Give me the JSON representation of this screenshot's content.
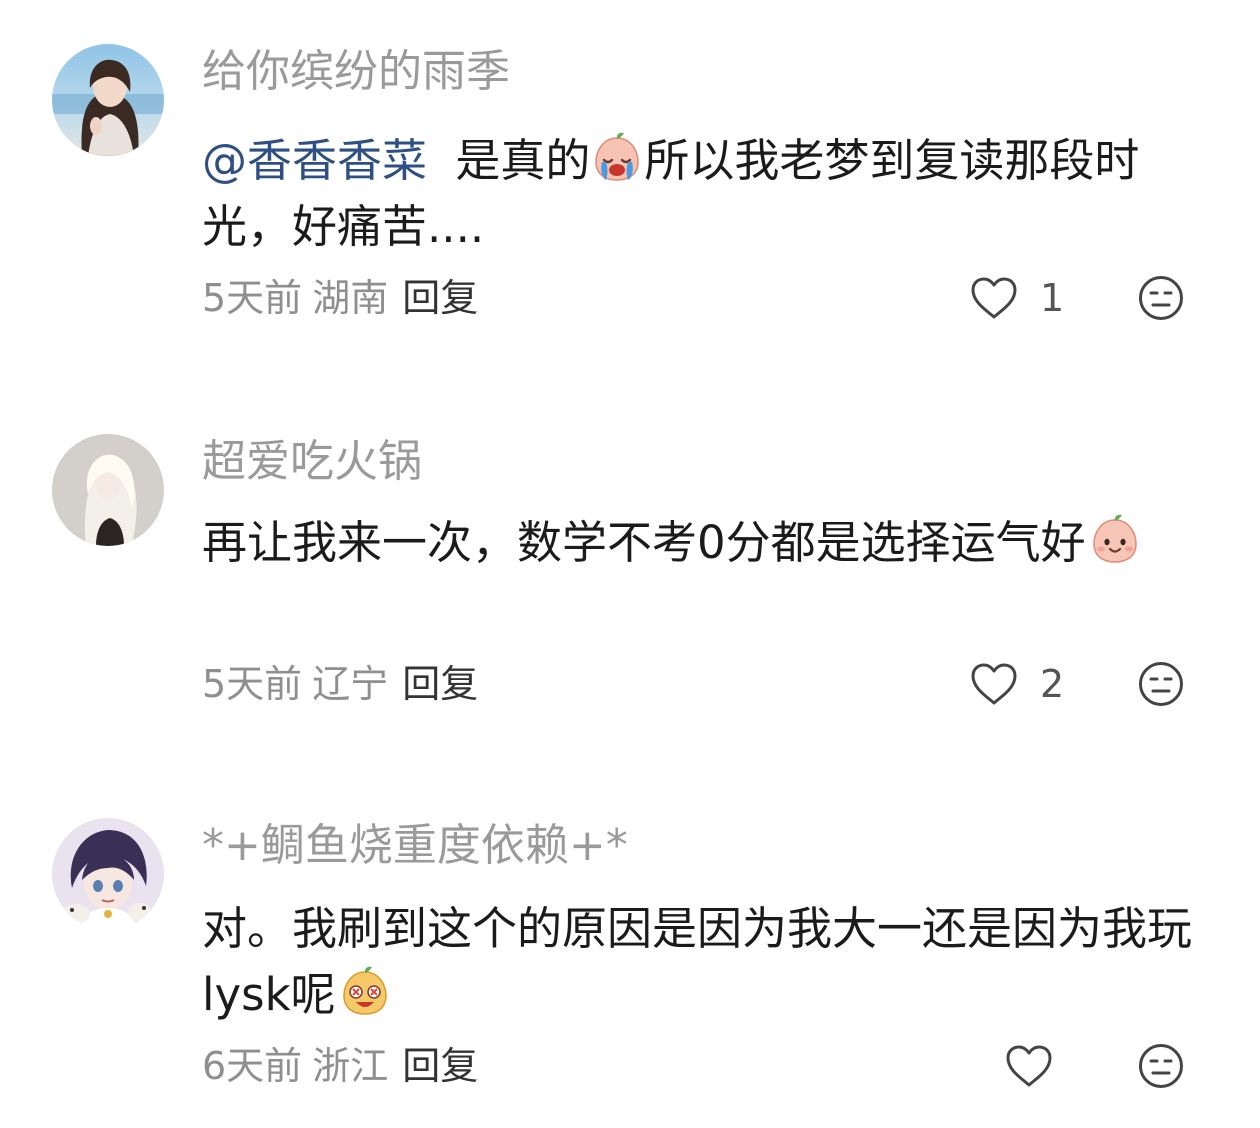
{
  "comments": [
    {
      "username": "给你缤纷的雨季",
      "mention": "@香香香菜",
      "text_before_emoji": "是真的",
      "text_after_emoji": "所以我老梦到复读那段时光，好痛苦....",
      "emoji": "crying-peach-emoji",
      "time": "5天前",
      "location": "湖南",
      "reply_label": "回复",
      "likes": "1"
    },
    {
      "username": "超爱吃火锅",
      "text_before_emoji": "再让我来一次，数学不考0分都是选择运气好",
      "emoji": "smiling-peach-emoji",
      "time": "5天前",
      "location": "辽宁",
      "reply_label": "回复",
      "likes": "2"
    },
    {
      "username": "*+鲷鱼烧重度依赖+*",
      "text_before_emoji": "对。我刷到这个的原因是因为我大一还是因为我玩lysk呢",
      "emoji": "dizzy-eyes-emoji",
      "time": "6天前",
      "location": "浙江",
      "reply_label": "回复",
      "likes": ""
    }
  ],
  "colors": {
    "username": "#9a9a9a",
    "mention": "#2e4f83",
    "text": "#1b1b1b",
    "meta": "#8f8f8f"
  },
  "icons": [
    "heart-outline-icon",
    "neutral-face-icon"
  ]
}
